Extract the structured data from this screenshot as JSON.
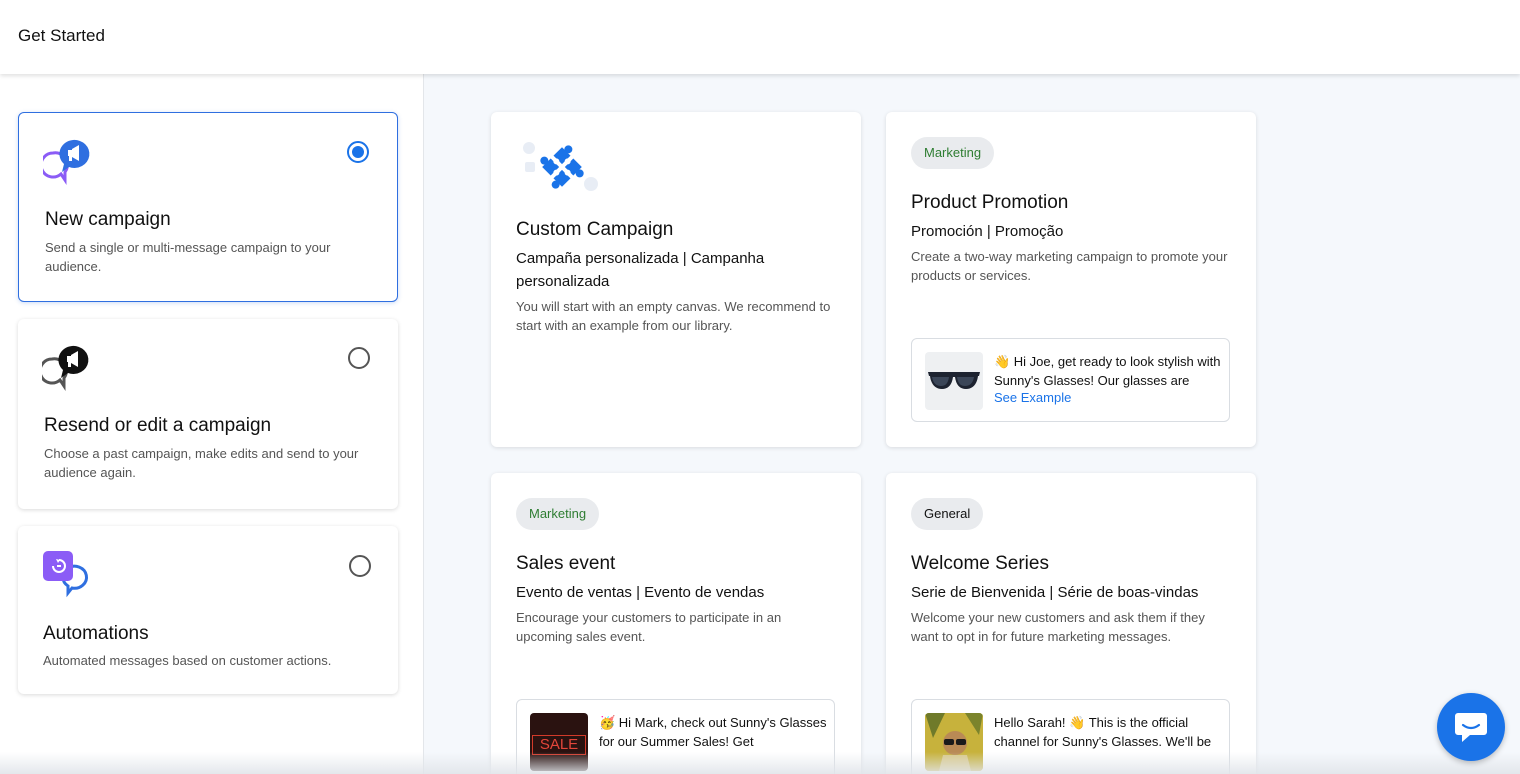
{
  "header": {
    "title": "Get Started"
  },
  "options": [
    {
      "title": "New campaign",
      "desc": "Send a single or multi-message campaign to your audience.",
      "icon": "megaphone-chat-icon",
      "selected": true
    },
    {
      "title": "Resend or edit a campaign",
      "desc": "Choose a past campaign, make edits and send to your audience again.",
      "icon": "megaphone-chat-dark-icon",
      "selected": false
    },
    {
      "title": "Automations",
      "desc": "Automated messages based on customer actions.",
      "icon": "automation-chat-icon",
      "selected": false
    }
  ],
  "templates": [
    {
      "icon": "puzzle-icon",
      "title": "Custom Campaign",
      "subtitle": "Campaña personalizada | Campanha personalizada",
      "desc": "You will start with an empty canvas. We recommend to start with an example from our library."
    },
    {
      "tag": "Marketing",
      "title": "Product Promotion",
      "subtitle": "Promoción | Promoção",
      "desc": "Create a two-way marketing campaign to promote your products or services.",
      "preview": {
        "thumb": "sunglasses-image",
        "message": "👋 Hi Joe, get ready to look stylish with Sunny's Glasses! Our glasses are",
        "link": "See Example"
      }
    },
    {
      "tag": "Marketing",
      "title": "Sales event",
      "subtitle": "Evento de ventas | Evento de vendas",
      "desc": "Encourage your customers to participate in an upcoming sales event.",
      "preview": {
        "thumb": "sale-sign-image",
        "thumb_text": "SALE",
        "message": "🥳 Hi Mark, check out Sunny's Glasses for our Summer Sales! Get"
      }
    },
    {
      "tag": "General",
      "title": "Welcome Series",
      "subtitle": "Serie de Bienvenida | Série de boas-vindas",
      "desc": "Welcome your new customers and ask them if they want to opt in for future marketing messages.",
      "preview": {
        "thumb": "woman-sunglasses-image",
        "message": "Hello Sarah! 👋 This is the official channel for Sunny's Glasses. We'll be"
      }
    }
  ],
  "colors": {
    "accent": "#1a73e8",
    "marketing_tag": "#2e7d32",
    "purple": "#7b4fd6"
  },
  "chat_button": {
    "icon": "chat-bubble-icon"
  }
}
